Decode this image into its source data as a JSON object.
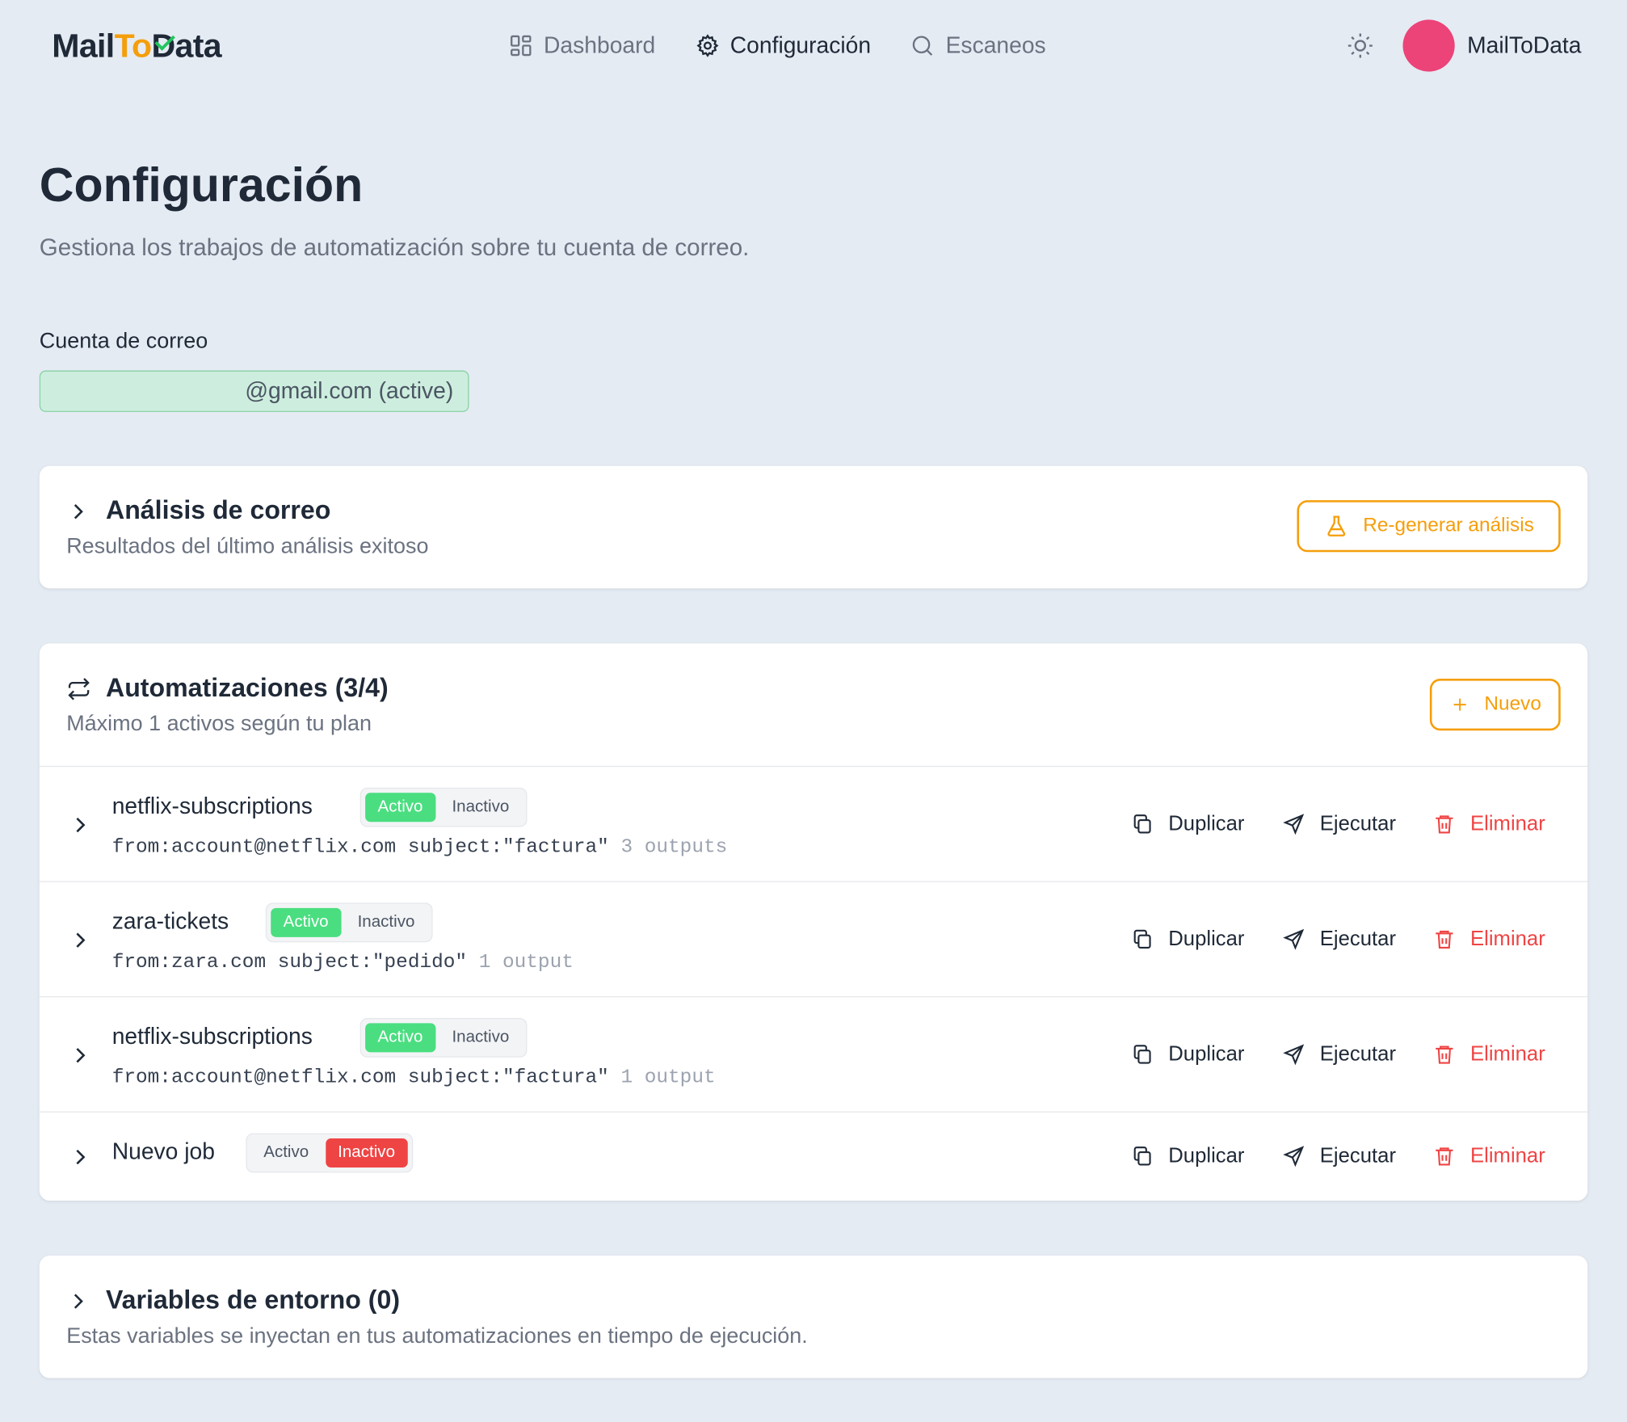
{
  "header": {
    "logo": {
      "part1": "Mail",
      "part2": "To",
      "part3": "Data"
    },
    "nav": [
      {
        "label": "Dashboard",
        "icon": "dashboard-icon"
      },
      {
        "label": "Configuración",
        "icon": "gear-icon"
      },
      {
        "label": "Escaneos",
        "icon": "search-icon"
      }
    ],
    "username": "MailToData",
    "avatar_color": "#ec4379"
  },
  "page": {
    "title": "Configuración",
    "subtitle": "Gestiona los trabajos de automatización sobre tu cuenta de correo."
  },
  "account": {
    "label": "Cuenta de correo",
    "value": "@gmail.com (active)"
  },
  "analysis": {
    "title": "Análisis de correo",
    "subtitle": "Resultados del último análisis exitoso",
    "button": "Re-generar análisis"
  },
  "automations": {
    "title": "Automatizaciones (3/4)",
    "subtitle": "Máximo 1 activos según tu plan",
    "new_button": "Nuevo",
    "toggle_on": "Activo",
    "toggle_off": "Inactivo",
    "actions": {
      "duplicate": "Duplicar",
      "run": "Ejecutar",
      "delete": "Eliminar"
    },
    "jobs": [
      {
        "name": "netflix-subscriptions",
        "active": true,
        "filter": "from:account@netflix.com subject:\"factura\"",
        "outputs": "3 outputs"
      },
      {
        "name": "zara-tickets",
        "active": true,
        "filter": "from:zara.com subject:\"pedido\"",
        "outputs": "1 output"
      },
      {
        "name": "netflix-subscriptions",
        "active": true,
        "filter": "from:account@netflix.com subject:\"factura\"",
        "outputs": "1 output"
      },
      {
        "name": "Nuevo job",
        "active": false,
        "filter": "",
        "outputs": ""
      }
    ]
  },
  "env": {
    "title": "Variables de entorno (0)",
    "subtitle": "Estas variables se inyectan en tus automatizaciones en tiempo de ejecución."
  },
  "colors": {
    "accent": "#f59e0b",
    "active_green": "#4ade80",
    "inactive_red": "#ef4444",
    "background": "#e5ebf3"
  }
}
